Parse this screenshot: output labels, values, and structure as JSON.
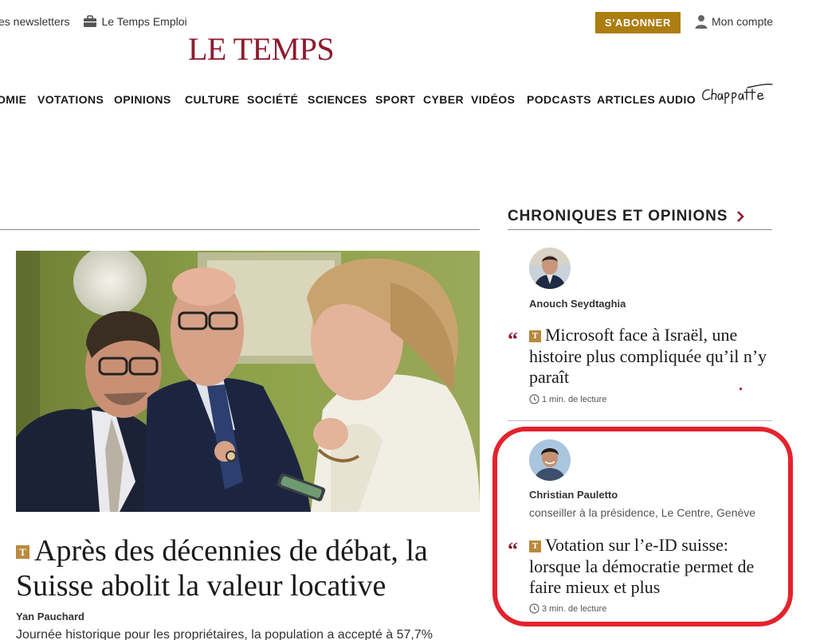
{
  "utility": {
    "newsletters": "es newsletters",
    "emploi": "Le Temps Emploi",
    "subscribe": "S'ABONNER",
    "account": "Mon compte"
  },
  "logo": "LE TEMPS",
  "nav": [
    "OMIE",
    "VOTATIONS",
    "OPINIONS",
    "CULTURE",
    "SOCIÉTÉ",
    "SCIENCES",
    "SPORT",
    "CYBER",
    "VIDÉOS",
    "PODCASTS",
    "ARTICLES AUDIO"
  ],
  "chappatte": "Chappatte",
  "hero": {
    "badge": "T",
    "title": "Après des décennies de débat, la Suisse abolit la valeur locative",
    "author": "Yan Pauchard",
    "lede": "Journée historique pour les propriétaires, la population a accepté à 57,7%"
  },
  "chroniques": {
    "heading": "CHRONIQUES ET OPINIONS",
    "items": [
      {
        "author": "Anouch Seydtaghia",
        "role": "",
        "quote_mark": "“",
        "badge": "T",
        "title": "Microsoft face à Israël, une histoire plus compliquée qu’il n’y paraît",
        "read_time": "1 min. de lecture"
      },
      {
        "author": "Christian Pauletto",
        "role": "conseiller à la présidence, Le Centre, Genève",
        "quote_mark": "“",
        "badge": "T",
        "title": "Votation sur l’e-ID suisse: lorsque la démocratie permet de faire mieux et plus",
        "read_time": "3 min. de lecture"
      }
    ]
  },
  "colors": {
    "brand": "#8c1b2f",
    "subscribe_bg": "#ac7d10",
    "badge": "#b98a3e",
    "highlight": "#e3232d"
  }
}
